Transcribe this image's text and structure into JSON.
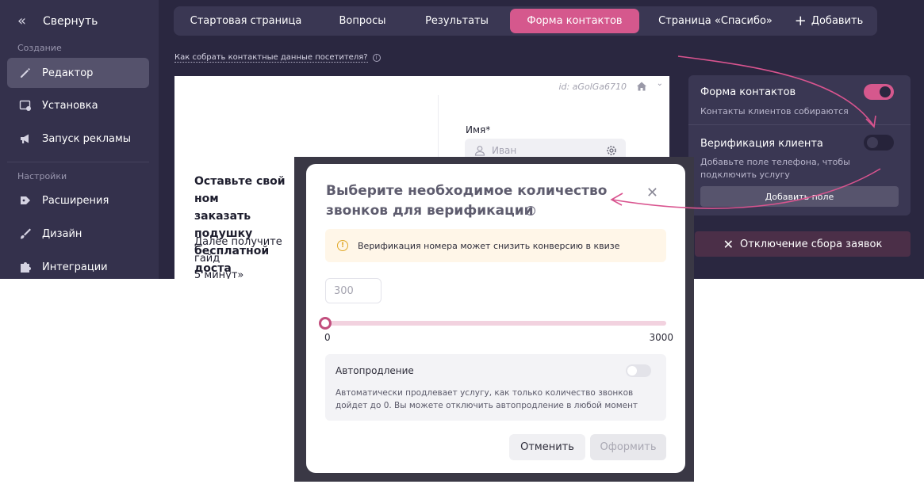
{
  "sidebar": {
    "collapse_label": "Свернуть",
    "section_create": "Создание",
    "section_settings": "Настройки",
    "items": [
      {
        "label": "Редактор",
        "icon": "pencil-icon"
      },
      {
        "label": "Установка",
        "icon": "install-icon"
      },
      {
        "label": "Запуск рекламы",
        "icon": "megaphone-icon"
      },
      {
        "label": "Расширения",
        "icon": "extension-icon"
      },
      {
        "label": "Дизайн",
        "icon": "brush-icon"
      },
      {
        "label": "Интеграции",
        "icon": "puzzle-icon"
      }
    ]
  },
  "tabs": {
    "items": [
      {
        "label": "Стартовая страница"
      },
      {
        "label": "Вопросы"
      },
      {
        "label": "Результаты"
      },
      {
        "label": "Форма контактов"
      },
      {
        "label": "Страница «Спасибо»"
      }
    ],
    "add_label": "Добавить",
    "active_color": "#d5588d"
  },
  "help_link": "Как собрать контактные данные посетителя?",
  "preview": {
    "id_label": "id: aGolGa6710",
    "name_label": "Имя*",
    "name_placeholder": "Иван",
    "heading": "Оставьте свой ном\nзаказать подушку\nбесплатной доста",
    "subtext": "Далее получите гайд\n5 минут»"
  },
  "panel": {
    "contact_form_title": "Форма контактов",
    "contact_form_desc": "Контакты клиентов собираются",
    "verification_title": "Верификация клиента",
    "verification_desc": "Добавьте поле телефона, чтобы подключить услугу",
    "add_field_label": "Добавить поле"
  },
  "disable_collection_label": "Отключение сбора заявок",
  "modal": {
    "title": "Выберите необходимое количество\nзвонков для верификации",
    "warning": "Верификация номера может снизить конверсию в квизе",
    "calls_input_placeholder": "300",
    "slider": {
      "min": "0",
      "max": "3000",
      "value": 0
    },
    "autorenew_title": "Автопродление",
    "autorenew_desc": "Автоматически продлевает услугу, как только количество звонков дойдет до 0. Вы можете отключить автопродление в любой момент",
    "cancel_label": "Отменить",
    "submit_label": "Оформить"
  },
  "colors": {
    "accent": "#d5588d",
    "annotation_arrow": "#d9548f"
  }
}
